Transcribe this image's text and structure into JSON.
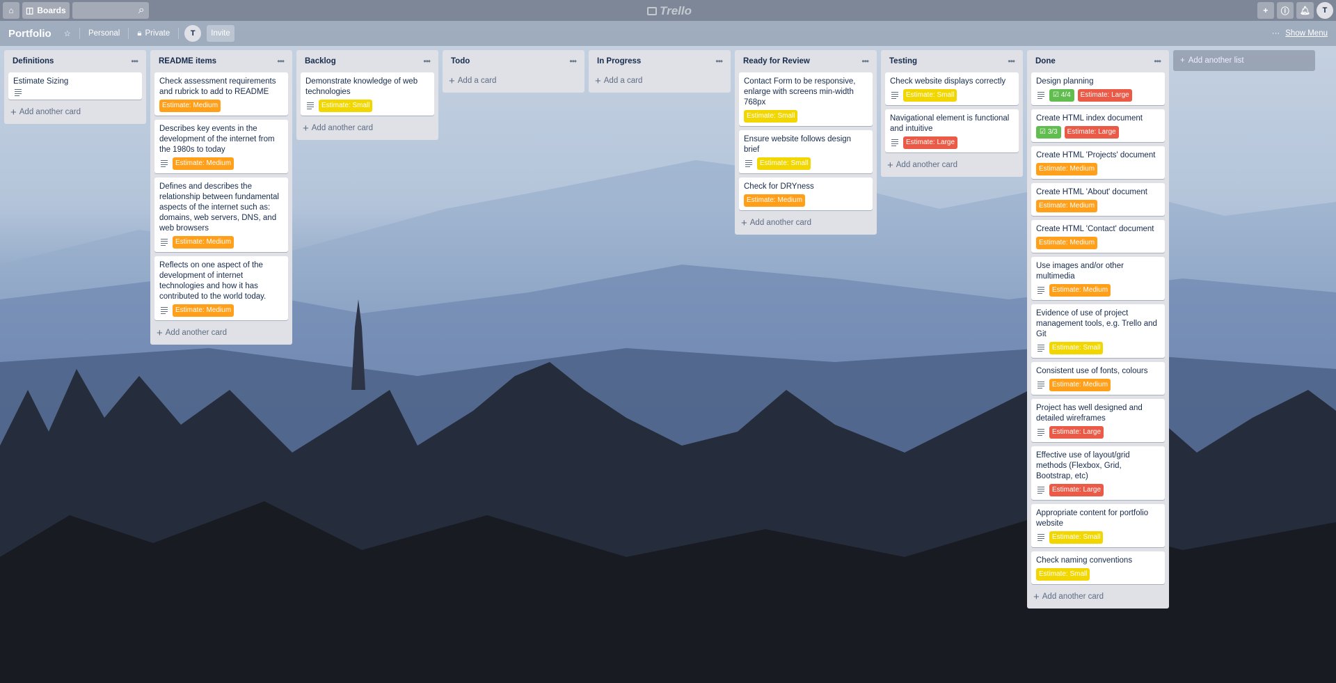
{
  "topbar": {
    "boards_label": "Boards",
    "logo_text": "Trello",
    "user_initial": "T"
  },
  "board": {
    "title": "Portfolio",
    "team": "Personal",
    "visibility": "Private",
    "member_initial": "T",
    "invite_label": "Invite",
    "show_menu_label": "Show Menu"
  },
  "add_card_label": "Add another card",
  "add_list_label": "Add another list",
  "colors": {
    "orange": "#ff9f1a",
    "yellow": "#f2d600",
    "red": "#eb5a46",
    "green": "#61bd4f"
  },
  "lists": [
    {
      "title": "Definitions",
      "cards": [
        {
          "title": "Estimate Sizing",
          "desc": true
        }
      ]
    },
    {
      "title": "README items",
      "cards": [
        {
          "title": "Check assessment requirements and rubrick to add to README",
          "label": "Estimate: Medium",
          "color": "orange"
        },
        {
          "title": "Describes key events in the development of the internet from the 1980s to today",
          "desc": true,
          "label": "Estimate: Medium",
          "color": "orange"
        },
        {
          "title": "Defines and describes the relationship between fundamental aspects of the internet such as: domains, web servers, DNS, and web browsers",
          "desc": true,
          "label": "Estimate: Medium",
          "color": "orange"
        },
        {
          "title": "Reflects on one aspect of the development of internet technologies and how it has contributed to the world today.",
          "desc": true,
          "label": "Estimate: Medium",
          "color": "orange"
        }
      ]
    },
    {
      "title": "Backlog",
      "cards": [
        {
          "title": "Demonstrate knowledge of web technologies",
          "desc": true,
          "label": "Estimate: Small",
          "color": "yellow"
        }
      ]
    },
    {
      "title": "Todo",
      "cards": [],
      "add_short": "Add a card"
    },
    {
      "title": "In Progress",
      "cards": [],
      "add_short": "Add a card"
    },
    {
      "title": "Ready for Review",
      "cards": [
        {
          "title": "Contact Form to be responsive, enlarge with screens min-width 768px",
          "label": "Estimate: Small",
          "color": "yellow"
        },
        {
          "title": "Ensure website follows design brief",
          "desc": true,
          "label": "Estimate: Small",
          "color": "yellow"
        },
        {
          "title": "Check for DRYness",
          "label": "Estimate: Medium",
          "color": "orange"
        }
      ]
    },
    {
      "title": "Testing",
      "cards": [
        {
          "title": "Check website displays correctly",
          "desc": true,
          "label": "Estimate: Small",
          "color": "yellow"
        },
        {
          "title": "Navigational element is functional and intuitive",
          "desc": true,
          "label": "Estimate: Large",
          "color": "red"
        }
      ]
    },
    {
      "title": "Done",
      "cards": [
        {
          "title": "Design planning",
          "desc": true,
          "checklist": "4/4",
          "label": "Estimate: Large",
          "color": "red"
        },
        {
          "title": "Create HTML index document",
          "checklist": "3/3",
          "label": "Estimate: Large",
          "color": "red"
        },
        {
          "title": "Create HTML 'Projects' document",
          "label": "Estimate: Medium",
          "color": "orange"
        },
        {
          "title": "Create HTML 'About' document",
          "label": "Estimate: Medium",
          "color": "orange"
        },
        {
          "title": "Create HTML 'Contact' document",
          "label": "Estimate: Medium",
          "color": "orange"
        },
        {
          "title": "Use images and/or other multimedia",
          "desc": true,
          "label": "Estimate: Medium",
          "color": "orange"
        },
        {
          "title": "Evidence of use of project management tools, e.g. Trello and Git",
          "desc": true,
          "label": "Estimate: Small",
          "color": "yellow"
        },
        {
          "title": "Consistent use of fonts, colours",
          "desc": true,
          "label": "Estimate: Medium",
          "color": "orange"
        },
        {
          "title": "Project has well designed and detailed wireframes",
          "desc": true,
          "label": "Estimate: Large",
          "color": "red"
        },
        {
          "title": "Effective use of layout/grid methods (Flexbox, Grid, Bootstrap, etc)",
          "desc": true,
          "label": "Estimate: Large",
          "color": "red"
        },
        {
          "title": "Appropriate content for portfolio website",
          "desc": true,
          "label": "Estimate: Small",
          "color": "yellow"
        },
        {
          "title": "Check naming conventions",
          "label": "Estimate: Small",
          "color": "yellow"
        }
      ]
    }
  ]
}
